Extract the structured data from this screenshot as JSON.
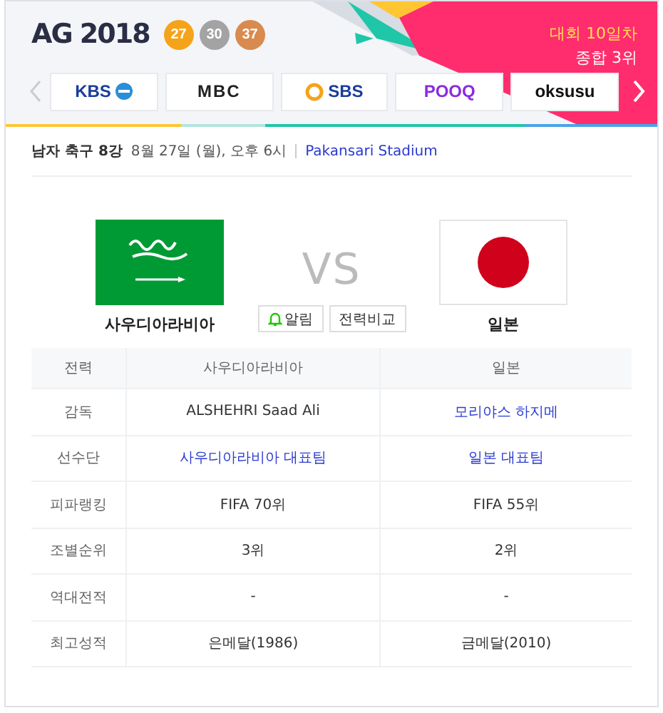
{
  "banner": {
    "logo": "AG 2018",
    "medals": [
      {
        "count": "27",
        "color": "#f5a31a"
      },
      {
        "count": "30",
        "color": "#a3a3a3"
      },
      {
        "count": "37",
        "color": "#d98a4e"
      }
    ],
    "day": "대회 10일차",
    "rank": "종합 3위",
    "channels": [
      {
        "name": "KBS",
        "kind": "kbs"
      },
      {
        "name": "MBC",
        "kind": "mbc"
      },
      {
        "name": "SBS",
        "kind": "sbs"
      },
      {
        "name": "POOQ",
        "kind": "pooq"
      },
      {
        "name": "oksusu",
        "kind": "oksusu"
      }
    ]
  },
  "match": {
    "round": "남자 축구 8강",
    "datetime": "8월 27일 (월), 오후 6시",
    "venue": "Pakansari Stadium",
    "home": {
      "name": "사우디아라비아",
      "kind": "saudi"
    },
    "away": {
      "name": "일본",
      "kind": "japan"
    },
    "vs": "VS",
    "buttons": [
      {
        "label": "알림",
        "kind": "alarm"
      },
      {
        "label": "전력비교",
        "kind": "plain"
      }
    ]
  },
  "table": {
    "columns": [
      "전력",
      "사우디아라비아",
      "일본"
    ],
    "rows": [
      [
        {
          "text": "감독",
          "link": false
        },
        {
          "text": "ALSHEHRI Saad Ali",
          "link": false
        },
        {
          "text": "모리야스 하지메",
          "link": true
        }
      ],
      [
        {
          "text": "선수단",
          "link": false
        },
        {
          "text": "사우디아라비아 대표팀",
          "link": true
        },
        {
          "text": "일본 대표팀",
          "link": true
        }
      ],
      [
        {
          "text": "피파랭킹",
          "link": false
        },
        {
          "text": "FIFA 70위",
          "link": false
        },
        {
          "text": "FIFA 55위",
          "link": false
        }
      ],
      [
        {
          "text": "조별순위",
          "link": false
        },
        {
          "text": "3위",
          "link": false
        },
        {
          "text": "2위",
          "link": false
        }
      ],
      [
        {
          "text": "역대전적",
          "link": false
        },
        {
          "text": "-",
          "link": false
        },
        {
          "text": "-",
          "link": false
        }
      ],
      [
        {
          "text": "최고성적",
          "link": false
        },
        {
          "text": "은메달(1986)",
          "link": false
        },
        {
          "text": "금메달(2010)",
          "link": false
        }
      ]
    ]
  }
}
